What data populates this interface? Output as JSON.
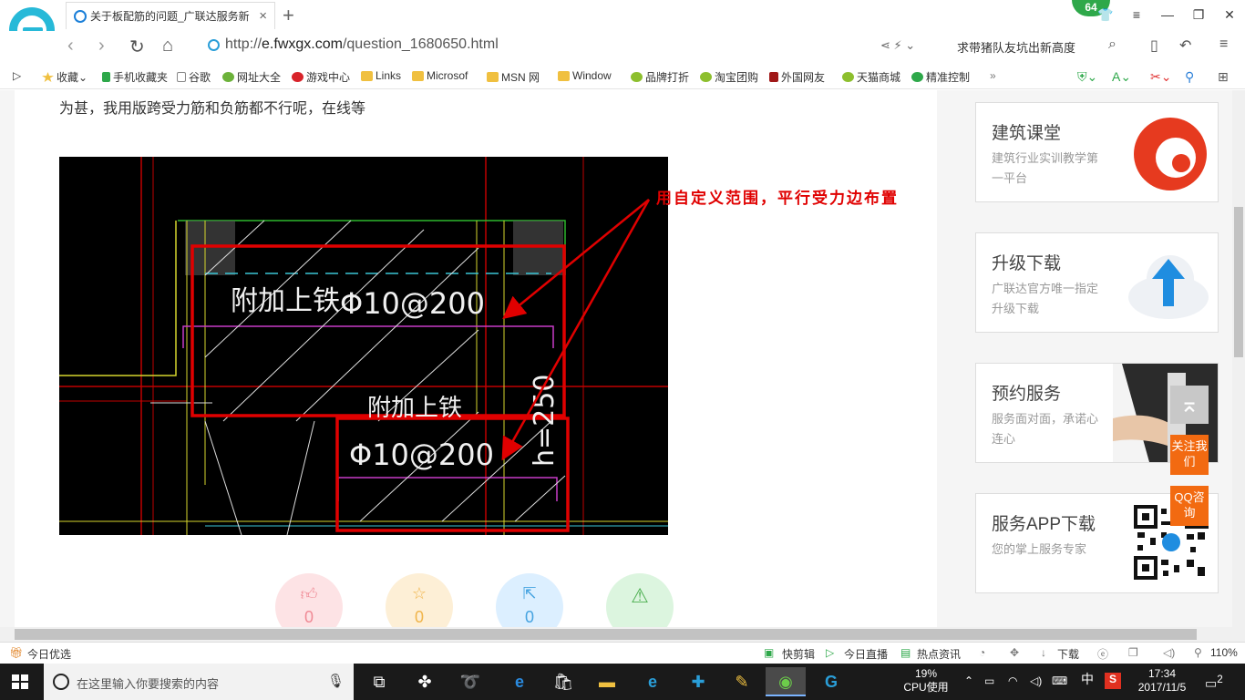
{
  "browser": {
    "tab_title": "关于板配筋的问题_广联达服务新",
    "tab_close": "×",
    "new_tab": "+",
    "notification_count": "64",
    "url_prefix": "http://",
    "url_domain": "e.fwxgx.com",
    "url_path": "/question_1680650.html",
    "search_suggestion": "求带猪队友坑出新高度",
    "zoom": "110%"
  },
  "bookmarks": [
    {
      "label": "收藏",
      "icon": "star-icon"
    },
    {
      "label": "手机收藏夹",
      "icon": "phone-icon"
    },
    {
      "label": "谷歌",
      "icon": "page-icon"
    },
    {
      "label": "网址大全",
      "icon": "globe-icon"
    },
    {
      "label": "游戏中心",
      "icon": "game-icon"
    },
    {
      "label": "Links",
      "icon": "folder-icon"
    },
    {
      "label": "Microsof",
      "icon": "folder-icon"
    },
    {
      "label": "MSN 网",
      "icon": "folder-icon"
    },
    {
      "label": "Window",
      "icon": "folder-icon"
    },
    {
      "label": "品牌打折",
      "icon": "leaf-icon"
    },
    {
      "label": "淘宝团购",
      "icon": "leaf-icon"
    },
    {
      "label": "外国网友",
      "icon": "bookmark-icon"
    },
    {
      "label": "天猫商城",
      "icon": "leaf-icon"
    },
    {
      "label": "精准控制",
      "icon": "wechat-icon"
    }
  ],
  "question": {
    "text": "为甚，我用版跨受力筋和负筋都不行呢，在线等",
    "annotation": "用自定义范围，平行受力边布置",
    "cad_label_1": "附加上铁",
    "cad_label_1_spec": "Φ10@200",
    "cad_label_2": "附加上铁",
    "cad_label_2_spec": "Φ10@200",
    "cad_label_h": "h=250"
  },
  "actions": [
    {
      "name": "like",
      "count": "0",
      "color": "#f7a1a8",
      "bg": "#fde3e5"
    },
    {
      "name": "favorite",
      "count": "0",
      "color": "#f0b44a",
      "bg": "#fdefd6"
    },
    {
      "name": "share",
      "count": "0",
      "color": "#46a3e0",
      "bg": "#dcefff"
    },
    {
      "name": "report",
      "count": "",
      "color": "#4caf50",
      "bg": "#dcf5df"
    }
  ],
  "sidebar": [
    {
      "title": "建筑课堂",
      "desc": "建筑行业实训教学第一平台"
    },
    {
      "title": "升级下载",
      "desc": "广联达官方唯一指定升级下载"
    },
    {
      "title": "预约服务",
      "desc": "服务面对面，承诺心连心"
    },
    {
      "title": "服务APP下载",
      "desc": "您的掌上服务专家"
    }
  ],
  "float_buttons": {
    "follow": "关注我们",
    "qq": "QQ咨询"
  },
  "statusbar": {
    "left": "今日优选",
    "items": [
      "快剪辑",
      "今日直播",
      "热点资讯"
    ],
    "download": "下载"
  },
  "taskbar": {
    "search_placeholder": "在这里输入你要搜索的内容",
    "cpu_percent": "19%",
    "cpu_label": "CPU使用",
    "ime": "中",
    "time": "17:34",
    "date": "2017/11/5",
    "notif_count": "2"
  }
}
